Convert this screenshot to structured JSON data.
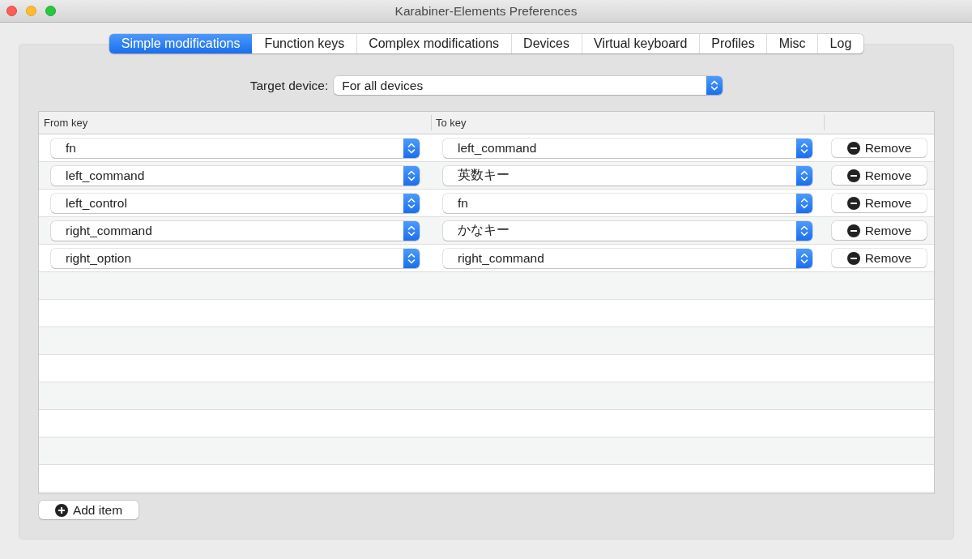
{
  "window": {
    "title": "Karabiner-Elements Preferences"
  },
  "tabs": [
    {
      "label": "Simple modifications",
      "selected": true
    },
    {
      "label": "Function keys",
      "selected": false
    },
    {
      "label": "Complex modifications",
      "selected": false
    },
    {
      "label": "Devices",
      "selected": false
    },
    {
      "label": "Virtual keyboard",
      "selected": false
    },
    {
      "label": "Profiles",
      "selected": false
    },
    {
      "label": "Misc",
      "selected": false
    },
    {
      "label": "Log",
      "selected": false
    }
  ],
  "target_device": {
    "label": "Target device:",
    "value": "For all devices"
  },
  "table": {
    "columns": [
      "From key",
      "To key"
    ],
    "rows": [
      {
        "from_key": "fn",
        "to_key": "left_command",
        "action": "Remove"
      },
      {
        "from_key": "left_command",
        "to_key": "英数キー",
        "action": "Remove"
      },
      {
        "from_key": "left_control",
        "to_key": "fn",
        "action": "Remove"
      },
      {
        "from_key": "right_command",
        "to_key": "かなキー",
        "action": "Remove"
      },
      {
        "from_key": "right_option",
        "to_key": "right_command",
        "action": "Remove"
      }
    ]
  },
  "add_button": "Add item"
}
